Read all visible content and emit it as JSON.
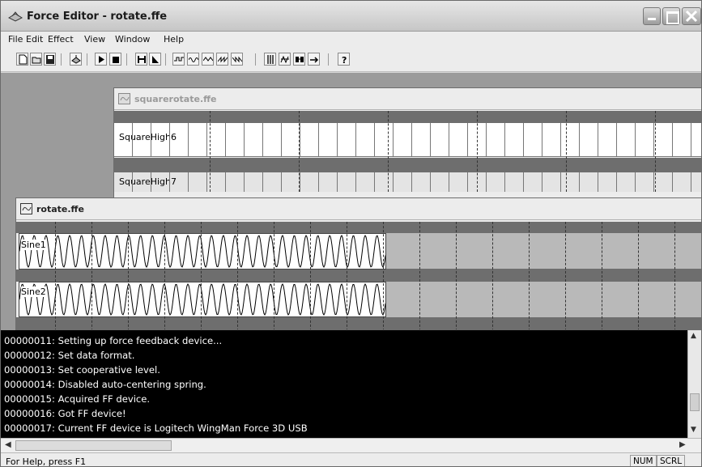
{
  "window": {
    "title": "Force Editor - rotate.ffe"
  },
  "menu": [
    "File",
    "Edit",
    "Effect",
    "View",
    "Window",
    "Help"
  ],
  "toolbar": {
    "buttons": [
      "new-icon",
      "open-icon",
      "save-icon",
      "force-device-icon",
      "play-icon",
      "stop-icon",
      "constant-force-icon",
      "ramp-force-icon",
      "square-wave-icon",
      "sine-wave-icon",
      "triangle-wave-icon",
      "sawtooth-up-icon",
      "sawtooth-down-icon",
      "spring-icon",
      "damper-icon",
      "inertia-icon",
      "friction-icon",
      "custom-force-icon",
      "about-icon"
    ]
  },
  "windows": {
    "square": {
      "title": "squarerotate.ffe",
      "tracks": [
        {
          "label": "SquareHigh6"
        },
        {
          "label": "SquareHigh7"
        }
      ]
    },
    "rotate": {
      "title": "rotate.ffe",
      "tracks": [
        {
          "label": "Sine1"
        },
        {
          "label": "Sine2"
        }
      ]
    }
  },
  "log": [
    "00000011: Setting up force feedback device...",
    "00000012: Set data format.",
    "00000013: Set cooperative level.",
    "00000014: Disabled auto-centering spring.",
    "00000015: Acquired FF device.",
    "00000016: Got FF device!",
    "00000017: Current FF device is Logitech WingMan Force 3D USB"
  ],
  "status": {
    "help": "For Help, press F1",
    "num": "NUM",
    "scrl": "SCRL"
  }
}
